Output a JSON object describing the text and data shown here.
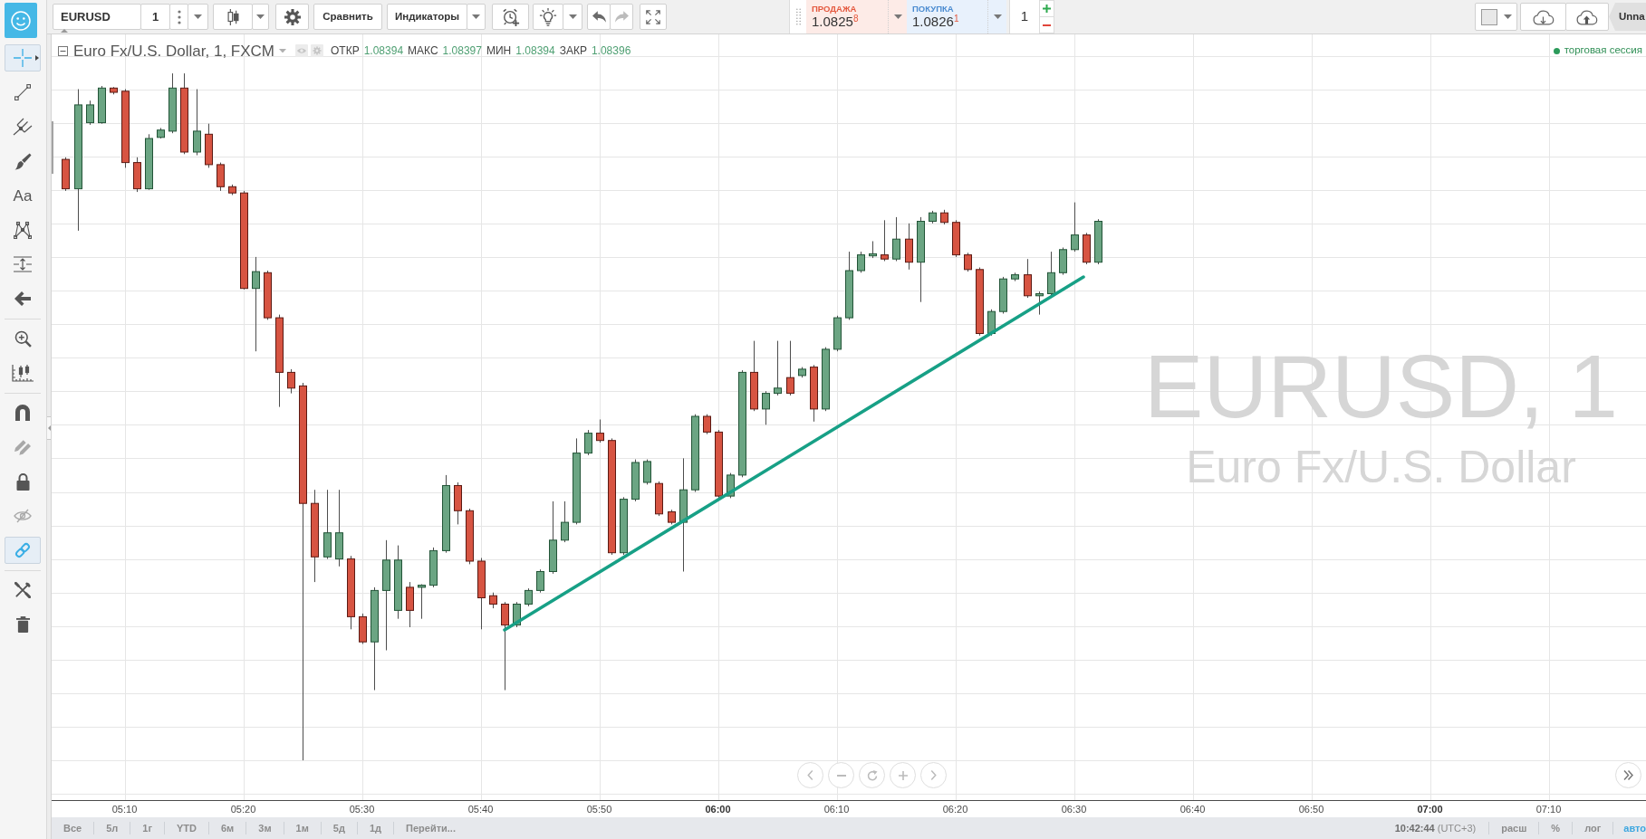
{
  "toolbar": {
    "symbol": "EURUSD",
    "interval": "1",
    "compare": "Сравнить",
    "indicators": "Индикаторы",
    "history": [
      {
        "kind": "undo",
        "disabled": false
      },
      {
        "kind": "redo",
        "disabled": true
      }
    ]
  },
  "trade_panel": {
    "sell": {
      "label": "ПРОДАЖА",
      "price": "1.0825$^{8}$"
    },
    "buy": {
      "label": "ПОКУПКА",
      "price": "1.0826$^{1}$"
    },
    "quantity": "1"
  },
  "layout": {
    "name": "Unna"
  },
  "drawing_toolbar": {
    "groups": [
      {
        "tools": [
          {
            "kind": "crosshair",
            "selected": true
          },
          {
            "kind": "trend-line",
            "selected": false
          },
          {
            "kind": "pitchfork",
            "selected": false
          },
          {
            "kind": "brush",
            "selected": false
          },
          {
            "kind": "text",
            "label": "Aa",
            "selected": false
          },
          {
            "kind": "pattern",
            "selected": false
          },
          {
            "kind": "measure",
            "selected": false
          },
          {
            "kind": "arrow",
            "selected": false
          }
        ]
      },
      {
        "tools": [
          {
            "kind": "zoom",
            "selected": false
          },
          {
            "kind": "ruler",
            "selected": false
          }
        ]
      },
      {
        "tools": [
          {
            "kind": "magnet",
            "selected": false
          },
          {
            "kind": "stay-in-drawing",
            "selected": false
          },
          {
            "kind": "lock",
            "selected": false
          },
          {
            "kind": "hide",
            "selected": false
          },
          {
            "kind": "link",
            "selected": true
          }
        ]
      },
      {
        "tools": [
          {
            "kind": "tools",
            "selected": false
          },
          {
            "kind": "trash",
            "selected": false
          }
        ]
      }
    ]
  },
  "chart": {
    "legend": {
      "title": "Euro Fx/U.S. Dollar, 1, FXCM",
      "values": [
        {
          "label": "ОТКР",
          "value": "1.08394"
        },
        {
          "label": "МАКС",
          "value": "1.08397"
        },
        {
          "label": "МИН",
          "value": "1.08394"
        },
        {
          "label": "ЗАКР",
          "value": "1.08396"
        }
      ]
    },
    "session": "торговая сессия",
    "watermark": {
      "symbol": "EURUSD, 1",
      "description": "Euro Fx/U.S. Dollar"
    },
    "time_axis": [
      {
        "label": "05:10",
        "major": false
      },
      {
        "label": "05:20",
        "major": false
      },
      {
        "label": "05:30",
        "major": false
      },
      {
        "label": "05:40",
        "major": false
      },
      {
        "label": "05:50",
        "major": false
      },
      {
        "label": "06:00",
        "major": true
      },
      {
        "label": "06:10",
        "major": false
      },
      {
        "label": "06:20",
        "major": false
      },
      {
        "label": "06:30",
        "major": false
      },
      {
        "label": "06:40",
        "major": false
      },
      {
        "label": "06:50",
        "major": false
      },
      {
        "label": "07:00",
        "major": true
      },
      {
        "label": "07:10",
        "major": false
      }
    ]
  },
  "bottom_bar": {
    "ranges": [
      "Все",
      "5л",
      "1г",
      "YTD",
      "6м",
      "3м",
      "1м",
      "5д",
      "1д"
    ],
    "goto": "Перейти...",
    "clock": "**10:42:44** (UTC+3)",
    "scale_options": [
      {
        "label": "расш",
        "selected": false
      },
      {
        "label": "%",
        "selected": false
      },
      {
        "label": "лог",
        "selected": false
      },
      {
        "label": "авто",
        "selected": true
      }
    ]
  }
}
